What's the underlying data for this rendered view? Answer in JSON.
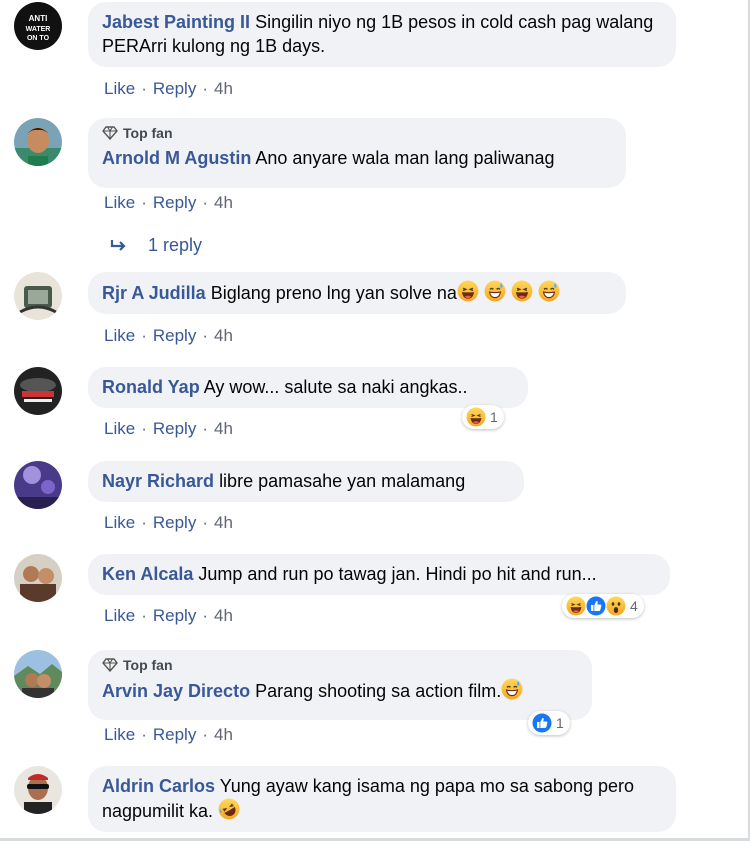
{
  "comments": [
    {
      "author": "Jabest Painting II",
      "text": "Singilin niyo ng 1B pesos in cold cash pag walang PERArri kulong ng 1B days.",
      "like": "Like",
      "reply": "Reply",
      "time": "4h"
    },
    {
      "badge": "Top fan",
      "author": "Arnold M Agustin",
      "text": "Ano anyare wala man lang paliwanag",
      "like": "Like",
      "reply": "Reply",
      "time": "4h",
      "replies_link": "1 reply"
    },
    {
      "author": "Rjr A Judilla",
      "text": "Biglang preno lng yan solve na",
      "like": "Like",
      "reply": "Reply",
      "time": "4h"
    },
    {
      "author": "Ronald Yap",
      "text": "Ay wow... salute sa naki angkas..",
      "like": "Like",
      "reply": "Reply",
      "time": "4h",
      "reaction_count": "1"
    },
    {
      "author": "Nayr Richard",
      "text": "libre pamasahe yan malamang",
      "like": "Like",
      "reply": "Reply",
      "time": "4h"
    },
    {
      "author": "Ken Alcala",
      "text": "Jump and run po tawag jan. Hindi po hit and run...",
      "like": "Like",
      "reply": "Reply",
      "time": "4h",
      "reaction_count": "4"
    },
    {
      "badge": "Top fan",
      "author": "Arvin Jay Directo",
      "text": "Parang shooting sa action film.",
      "like": "Like",
      "reply": "Reply",
      "time": "4h",
      "reaction_count": "1"
    },
    {
      "author": "Aldrin Carlos",
      "text": "Yung ayaw kang isama ng papa mo sa sabong pero nagpumilit ka.",
      "like": "Like",
      "reply": "Reply",
      "time": "4h"
    }
  ],
  "avatar_label": "ANTI WATER ON TO"
}
